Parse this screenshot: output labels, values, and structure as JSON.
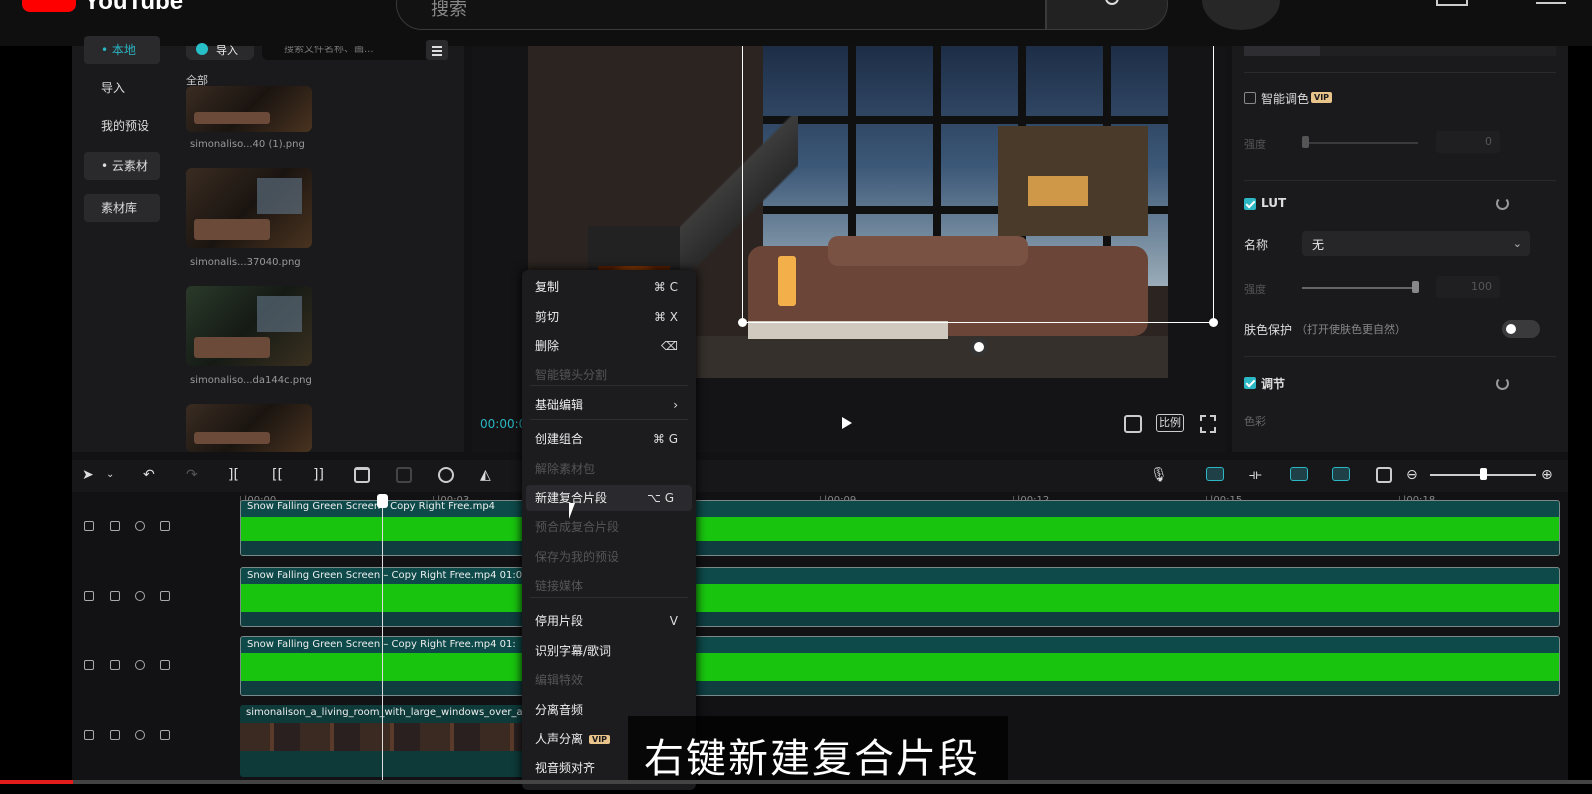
{
  "youtube": {
    "brand": "YouTube",
    "search_placeholder": "搜索"
  },
  "nav": {
    "items": [
      "• 本地",
      "导入",
      "我的预设",
      "• 云素材",
      "素材库"
    ]
  },
  "media": {
    "import_label": "导入",
    "search_placeholder": "搜索文件名称、画...",
    "all_label": "全部",
    "files": [
      "simonaliso...40 (1).png",
      "simonalis...37040.png",
      "simonaliso...da144c.png"
    ]
  },
  "preview": {
    "timecode": "00:00:0",
    "ratio_label": "比例"
  },
  "right_panel": {
    "smart_color_label": "智能调色",
    "vip": "VIP",
    "strength_label": "强度",
    "strength_value_1": "0",
    "lut_label": "LUT",
    "name_label": "名称",
    "name_value": "无",
    "strength_value_2": "100",
    "skin_protect_label": "肤色保护",
    "skin_protect_hint": "（打开使肤色更自然）",
    "adjust_label": "调节",
    "color_label": "色彩"
  },
  "ruler": {
    "ticks": [
      "|00:00",
      "|00:03",
      "|00:09",
      "|00:12",
      "|00:15",
      "|00:18"
    ]
  },
  "tracks": {
    "clips": [
      "Snow Falling Green Screen - Copy Right Free.mp4",
      "Snow Falling Green Screen – Copy Right Free.mp4  01:0",
      "Snow Falling Green Screen – Copy Right Free.mp4  01:",
      "simonalison_a_living_room_with_large_windows_over_a_"
    ]
  },
  "context_menu": {
    "items": [
      {
        "label": "复制",
        "shortcut": "⌘  C",
        "disabled": false
      },
      {
        "label": "剪切",
        "shortcut": "⌘  X",
        "disabled": false
      },
      {
        "label": "删除",
        "shortcut": "⌫",
        "disabled": false
      },
      {
        "label": "智能镜头分割",
        "shortcut": "",
        "disabled": true
      },
      {
        "label": "基础编辑",
        "shortcut": "›",
        "disabled": false
      },
      {
        "label": "创建组合",
        "shortcut": "⌘  G",
        "disabled": false
      },
      {
        "label": "解除素材包",
        "shortcut": "",
        "disabled": true
      },
      {
        "label": "新建复合片段",
        "shortcut": "⌥  G",
        "disabled": false
      },
      {
        "label": "预合成复合片段",
        "shortcut": "",
        "disabled": true
      },
      {
        "label": "保存为我的预设",
        "shortcut": "",
        "disabled": true
      },
      {
        "label": "链接媒体",
        "shortcut": "",
        "disabled": true
      },
      {
        "label": "停用片段",
        "shortcut": "V",
        "disabled": false
      },
      {
        "label": "识别字幕/歌词",
        "shortcut": "",
        "disabled": false
      },
      {
        "label": "编辑特效",
        "shortcut": "",
        "disabled": true
      },
      {
        "label": "分离音频",
        "shortcut": "",
        "disabled": false
      },
      {
        "label": "人声分离",
        "shortcut": "",
        "disabled": false
      },
      {
        "label": "视音频对齐",
        "shortcut": "",
        "disabled": false
      }
    ],
    "vip": "VIP"
  },
  "subtitle": "右键新建复合片段",
  "colors": {
    "accent": "#2bb8c4",
    "clip_green": "#19c40f",
    "youtube_red": "#ff0000"
  }
}
